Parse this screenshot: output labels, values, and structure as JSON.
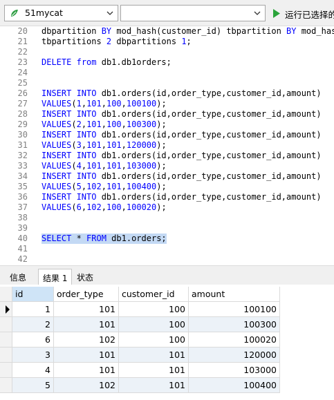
{
  "toolbar": {
    "connection": "51mycat",
    "database": "",
    "run_label": "运行已选择的",
    "colors": {
      "run_green": "#2aa33a",
      "conn_green": "#2f9e44"
    }
  },
  "editor": {
    "lines": [
      {
        "n": "20",
        "parts": [
          [
            "t",
            "dbpartition "
          ],
          [
            "k",
            "BY"
          ],
          [
            "t",
            " mod_hash(customer_id) tbpartition "
          ],
          [
            "k",
            "BY"
          ],
          [
            "t",
            " mod_hash(customer_id)"
          ]
        ]
      },
      {
        "n": "21",
        "parts": [
          [
            "t",
            "tbpartitions "
          ],
          [
            "n",
            "2"
          ],
          [
            "t",
            " dbpartitions "
          ],
          [
            "n",
            "1"
          ],
          [
            "t",
            ";"
          ]
        ]
      },
      {
        "n": "22",
        "parts": []
      },
      {
        "n": "23",
        "parts": [
          [
            "k",
            "DELETE"
          ],
          [
            "t",
            " "
          ],
          [
            "k",
            "from"
          ],
          [
            "t",
            " db1.db1orders;"
          ]
        ]
      },
      {
        "n": "24",
        "parts": []
      },
      {
        "n": "25",
        "parts": []
      },
      {
        "n": "26",
        "parts": [
          [
            "k",
            "INSERT INTO"
          ],
          [
            "t",
            " db1.orders(id,order_type,customer_id,amount)"
          ]
        ]
      },
      {
        "n": "27",
        "parts": [
          [
            "k",
            "VALUES"
          ],
          [
            "t",
            "("
          ],
          [
            "n",
            "1"
          ],
          [
            "t",
            ","
          ],
          [
            "n",
            "101"
          ],
          [
            "t",
            ","
          ],
          [
            "n",
            "100"
          ],
          [
            "t",
            ","
          ],
          [
            "n",
            "100100"
          ],
          [
            "t",
            ");"
          ]
        ]
      },
      {
        "n": "28",
        "parts": [
          [
            "k",
            "INSERT INTO"
          ],
          [
            "t",
            " db1.orders(id,order_type,customer_id,amount)"
          ]
        ]
      },
      {
        "n": "29",
        "parts": [
          [
            "k",
            "VALUES"
          ],
          [
            "t",
            "("
          ],
          [
            "n",
            "2"
          ],
          [
            "t",
            ","
          ],
          [
            "n",
            "101"
          ],
          [
            "t",
            ","
          ],
          [
            "n",
            "100"
          ],
          [
            "t",
            ","
          ],
          [
            "n",
            "100300"
          ],
          [
            "t",
            ");"
          ]
        ]
      },
      {
        "n": "30",
        "parts": [
          [
            "k",
            "INSERT INTO"
          ],
          [
            "t",
            " db1.orders(id,order_type,customer_id,amount)"
          ]
        ]
      },
      {
        "n": "31",
        "parts": [
          [
            "k",
            "VALUES"
          ],
          [
            "t",
            "("
          ],
          [
            "n",
            "3"
          ],
          [
            "t",
            ","
          ],
          [
            "n",
            "101"
          ],
          [
            "t",
            ","
          ],
          [
            "n",
            "101"
          ],
          [
            "t",
            ","
          ],
          [
            "n",
            "120000"
          ],
          [
            "t",
            ");"
          ]
        ]
      },
      {
        "n": "32",
        "parts": [
          [
            "k",
            "INSERT INTO"
          ],
          [
            "t",
            " db1.orders(id,order_type,customer_id,amount)"
          ]
        ]
      },
      {
        "n": "33",
        "parts": [
          [
            "k",
            "VALUES"
          ],
          [
            "t",
            "("
          ],
          [
            "n",
            "4"
          ],
          [
            "t",
            ","
          ],
          [
            "n",
            "101"
          ],
          [
            "t",
            ","
          ],
          [
            "n",
            "101"
          ],
          [
            "t",
            ","
          ],
          [
            "n",
            "103000"
          ],
          [
            "t",
            ");"
          ]
        ]
      },
      {
        "n": "34",
        "parts": [
          [
            "k",
            "INSERT INTO"
          ],
          [
            "t",
            " db1.orders(id,order_type,customer_id,amount)"
          ]
        ]
      },
      {
        "n": "35",
        "parts": [
          [
            "k",
            "VALUES"
          ],
          [
            "t",
            "("
          ],
          [
            "n",
            "5"
          ],
          [
            "t",
            ","
          ],
          [
            "n",
            "102"
          ],
          [
            "t",
            ","
          ],
          [
            "n",
            "101"
          ],
          [
            "t",
            ","
          ],
          [
            "n",
            "100400"
          ],
          [
            "t",
            ");"
          ]
        ]
      },
      {
        "n": "36",
        "parts": [
          [
            "k",
            "INSERT INTO"
          ],
          [
            "t",
            " db1.orders(id,order_type,customer_id,amount)"
          ]
        ]
      },
      {
        "n": "37",
        "parts": [
          [
            "k",
            "VALUES"
          ],
          [
            "t",
            "("
          ],
          [
            "n",
            "6"
          ],
          [
            "t",
            ","
          ],
          [
            "n",
            "102"
          ],
          [
            "t",
            ","
          ],
          [
            "n",
            "100"
          ],
          [
            "t",
            ","
          ],
          [
            "n",
            "100020"
          ],
          [
            "t",
            ");"
          ]
        ]
      },
      {
        "n": "38",
        "parts": []
      },
      {
        "n": "39",
        "parts": []
      },
      {
        "n": "40",
        "selected": true,
        "parts": [
          [
            "k",
            "SELECT"
          ],
          [
            "t",
            " * "
          ],
          [
            "k",
            "FROM"
          ],
          [
            "t",
            " db1.orders;"
          ]
        ]
      },
      {
        "n": "41",
        "parts": []
      },
      {
        "n": "42",
        "parts": []
      }
    ]
  },
  "tabs": [
    {
      "label": "信息",
      "active": false
    },
    {
      "label": "结果 1",
      "active": true
    },
    {
      "label": "状态",
      "active": false
    }
  ],
  "results": {
    "columns": [
      "id",
      "order_type",
      "customer_id",
      "amount"
    ],
    "rows": [
      [
        "1",
        "101",
        "100",
        "100100"
      ],
      [
        "2",
        "101",
        "100",
        "100300"
      ],
      [
        "6",
        "102",
        "100",
        "100020"
      ],
      [
        "3",
        "101",
        "101",
        "120000"
      ],
      [
        "4",
        "101",
        "101",
        "103000"
      ],
      [
        "5",
        "102",
        "101",
        "100400"
      ]
    ],
    "current_row_index": 0
  }
}
